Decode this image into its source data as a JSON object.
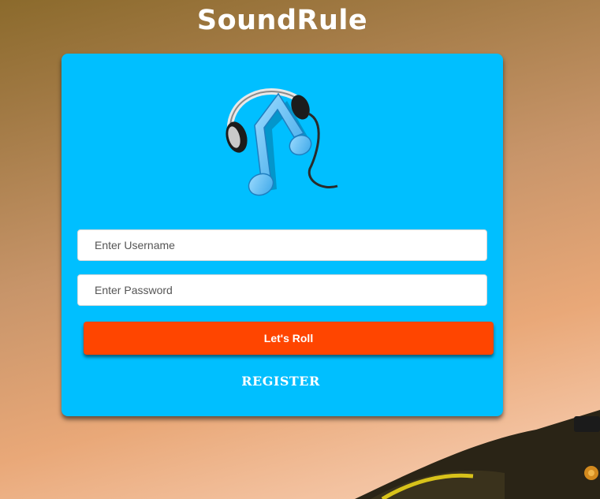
{
  "header": {
    "title": "SoundRule"
  },
  "logo": {
    "icon": "headphones-music-note-icon"
  },
  "form": {
    "username_placeholder": "Enter Username",
    "username_value": "",
    "password_placeholder": "Enter Password",
    "password_value": "",
    "submit_label": "Let's Roll",
    "register_label": "REGISTER"
  },
  "colors": {
    "card": "#00bfff",
    "submit_button": "#ff4500",
    "title_text": "#ffffff"
  }
}
